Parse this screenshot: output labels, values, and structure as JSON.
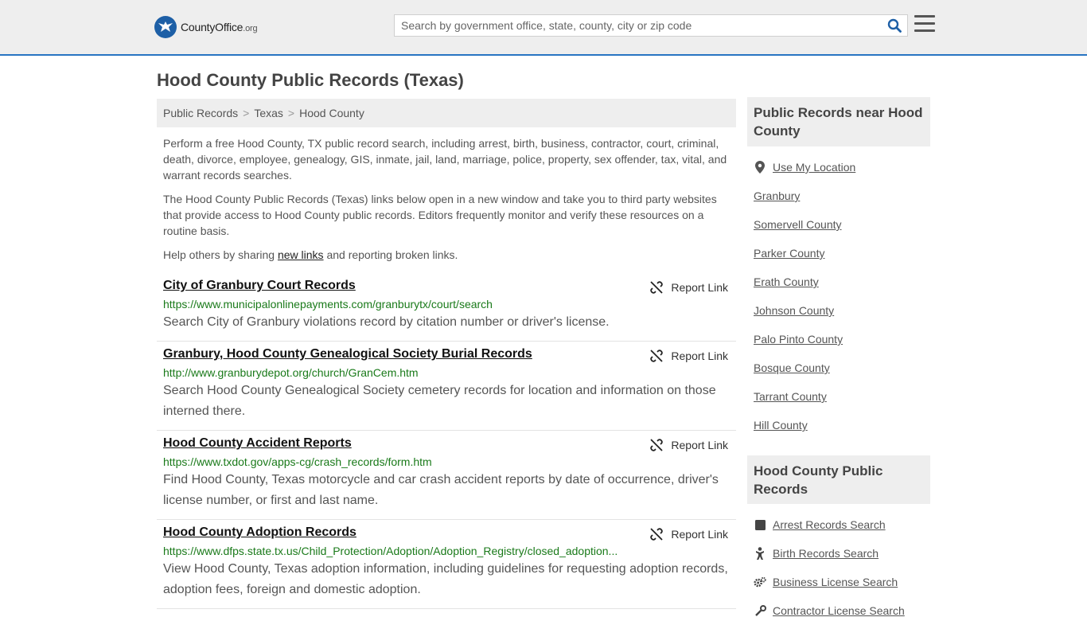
{
  "header": {
    "logo_main": "CountyOffice",
    "logo_suffix": ".org",
    "search_placeholder": "Search by government office, state, county, city or zip code"
  },
  "page": {
    "title": "Hood County Public Records (Texas)"
  },
  "breadcrumb": [
    "Public Records",
    "Texas",
    "Hood County"
  ],
  "intro": {
    "p1": "Perform a free Hood County, TX public record search, including arrest, birth, business, contractor, court, criminal, death, divorce, employee, genealogy, GIS, inmate, jail, land, marriage, police, property, sex offender, tax, vital, and warrant records searches.",
    "p2": "The Hood County Public Records (Texas) links below open in a new window and take you to third party websites that provide access to Hood County public records. Editors frequently monitor and verify these resources on a routine basis.",
    "p3_before": "Help others by sharing ",
    "p3_link": "new links",
    "p3_after": " and reporting broken links."
  },
  "report_label": "Report Link",
  "records": [
    {
      "title": "City of Granbury Court Records",
      "url": "https://www.municipalonlinepayments.com/granburytx/court/search",
      "desc": "Search City of Granbury violations record by citation number or driver's license."
    },
    {
      "title": "Granbury, Hood County Genealogical Society Burial Records",
      "url": "http://www.granburydepot.org/church/GranCem.htm",
      "desc": "Search Hood County Genealogical Society cemetery records for location and information on those interned there."
    },
    {
      "title": "Hood County Accident Reports",
      "url": "https://www.txdot.gov/apps-cg/crash_records/form.htm",
      "desc": "Find Hood County, Texas motorcycle and car crash accident reports by date of occurrence, driver's license number, or first and last name."
    },
    {
      "title": "Hood County Adoption Records",
      "url": "https://www.dfps.state.tx.us/Child_Protection/Adoption/Adoption_Registry/closed_adoption...",
      "desc": "View Hood County, Texas adoption information, including guidelines for requesting adoption records, adoption fees, foreign and domestic adoption."
    }
  ],
  "sidebar": {
    "near_title": "Public Records near Hood County",
    "near_items": [
      {
        "label": "Use My Location",
        "icon": "location-pin-icon"
      },
      {
        "label": "Granbury"
      },
      {
        "label": "Somervell County"
      },
      {
        "label": "Parker County"
      },
      {
        "label": "Erath County"
      },
      {
        "label": "Johnson County"
      },
      {
        "label": "Palo Pinto County"
      },
      {
        "label": "Bosque County"
      },
      {
        "label": "Tarrant County"
      },
      {
        "label": "Hill County"
      }
    ],
    "records_title": "Hood County Public Records",
    "records_items": [
      {
        "label": "Arrest Records Search",
        "icon": "square-icon"
      },
      {
        "label": "Birth Records Search",
        "icon": "baby-icon"
      },
      {
        "label": "Business License Search",
        "icon": "gears-icon"
      },
      {
        "label": "Contractor License Search",
        "icon": "tools-icon"
      }
    ]
  },
  "colors": {
    "accent": "#2874c2",
    "url_green": "#1a7a1a",
    "panel_gray": "#eeeeee"
  }
}
